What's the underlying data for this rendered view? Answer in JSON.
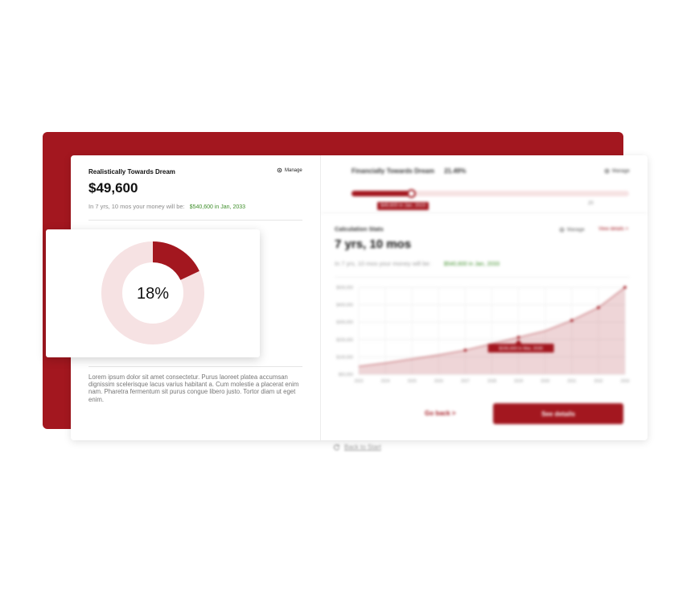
{
  "colors": {
    "brand": "#a3171f",
    "brand_light": "#f6e2e3",
    "positive": "#3f8f2b"
  },
  "left": {
    "title": "Realistically Towards Dream",
    "manage_label": "Manage",
    "amount": "$49,600",
    "subtitle": "In 7 yrs, 10 mos your money will be:",
    "projection": "$540,600 in Jan, 2033",
    "donut_label": "18%",
    "donut_fraction": 0.18,
    "lorem": "Lorem ipsum dolor sit amet consectetur. Purus laoreet platea accumsan dignissim scelerisque lacus varius habitant a. Cum molestie a placerat enim nam. Pharetra fermentum sit purus congue libero justo. Tortor diam ut eget enim."
  },
  "right": {
    "title": "Financially Towards Dream",
    "percent": "21.49%",
    "manage_label": "Manage",
    "progress_fraction": 0.2149,
    "progress_tag": "$49,600 in Jan, 2023",
    "progress_end": "20",
    "stats_title": "Calculation Stats",
    "stats_manage": "Manage",
    "view_details": "View details >",
    "duration": "7 yrs, 10 mos",
    "subtitle": "In 7 yrs, 10 mos your money will be:",
    "projection": "$540,600 in Jan, 2033",
    "go_back": "Go back >",
    "see_details": "See details"
  },
  "chart_data": {
    "type": "area",
    "x": [
      "2023",
      "2024",
      "2025",
      "2026",
      "2027",
      "2028",
      "2029",
      "2030",
      "2031",
      "2032",
      "2033"
    ],
    "y_ticks": [
      "$500,000",
      "$400,000",
      "$300,000",
      "$200,000",
      "$100,000",
      "$50,000"
    ],
    "values": [
      49600,
      70000,
      95000,
      120000,
      150000,
      190000,
      230000,
      270000,
      335000,
      415000,
      540600
    ],
    "ylim": [
      0,
      540600
    ],
    "markers": [
      4,
      6,
      8,
      9,
      10
    ],
    "annotation": {
      "index": 6,
      "text": "$155,600 in Mar, 2030"
    }
  },
  "footer": {
    "back_to_start": "Back to Start"
  }
}
